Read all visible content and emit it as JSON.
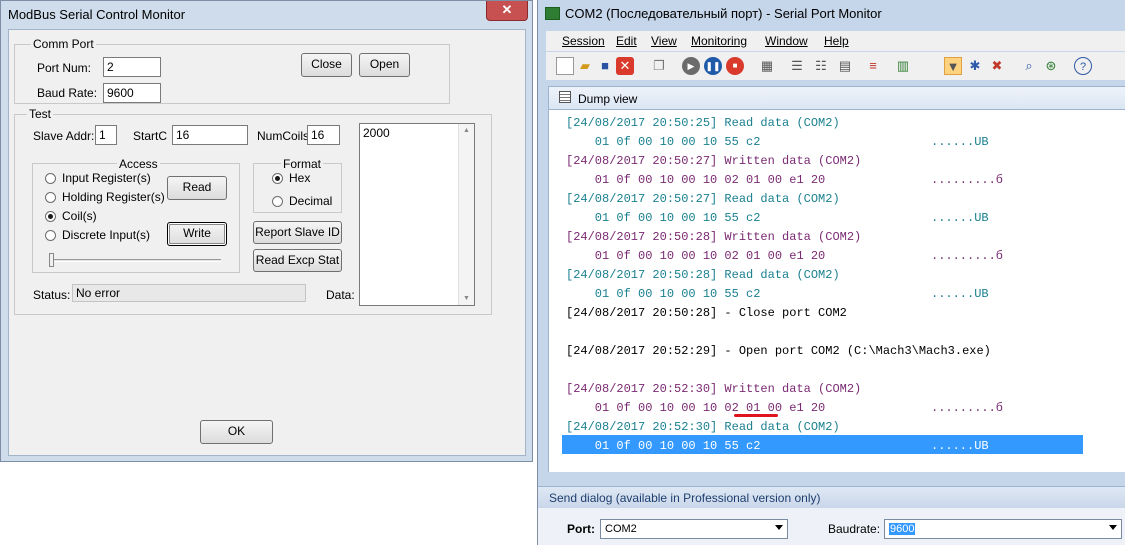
{
  "left_window": {
    "title": "ModBus Serial Control Monitor",
    "close_glyph": "✕",
    "comm_port": {
      "group_label": "Comm Port",
      "port_num_label": "Port Num:",
      "port_num_value": "2",
      "baud_rate_label": "Baud Rate:",
      "baud_rate_value": "9600",
      "close_button": "Close",
      "open_button": "Open"
    },
    "test": {
      "group_label": "Test",
      "slave_addr_label": "Slave Addr:",
      "slave_addr_value": "1",
      "startc_label": "StartC",
      "startc_value": "16",
      "numcoils_label": "NumCoils:",
      "numcoils_value": "16",
      "data_value": "2000",
      "access": {
        "label": "Access",
        "options": [
          "Input Register(s)",
          "Holding Register(s)",
          "Coil(s)",
          "Discrete Input(s)"
        ],
        "selected": "Coil(s)",
        "read_button": "Read",
        "write_button": "Write"
      },
      "format": {
        "label": "Format",
        "options": [
          "Hex",
          "Decimal"
        ],
        "selected": "Hex"
      },
      "report_slave_id_button": "Report Slave ID",
      "read_excp_stat_button": "Read Excp Stat",
      "status_label": "Status:",
      "status_value": "No error",
      "data_label": "Data:"
    },
    "ok_button": "OK"
  },
  "right_window": {
    "title": "COM2 (Последовательный порт) - Serial Port Monitor",
    "menu": [
      "Session",
      "Edit",
      "View",
      "Monitoring",
      "Window",
      "Help"
    ],
    "panel_title": "Dump view",
    "log": [
      {
        "text": "[24/08/2017 20:50:25] Read data (COM2)",
        "kind": "read-hdr"
      },
      {
        "text": "    01 0f 00 10 00 10 55 c2",
        "ascii": "......UB",
        "kind": "data"
      },
      {
        "text": "[24/08/2017 20:50:27] Written data (COM2)",
        "kind": "write-hdr"
      },
      {
        "text": "    01 0f 00 10 00 10 02 01 00 e1 20",
        "ascii": ".........б",
        "kind": "data-w"
      },
      {
        "text": "[24/08/2017 20:50:27] Read data (COM2)",
        "kind": "read-hdr"
      },
      {
        "text": "    01 0f 00 10 00 10 55 c2",
        "ascii": "......UB",
        "kind": "data"
      },
      {
        "text": "[24/08/2017 20:50:28] Written data (COM2)",
        "kind": "write-hdr"
      },
      {
        "text": "    01 0f 00 10 00 10 02 01 00 e1 20",
        "ascii": ".........б",
        "kind": "data-w"
      },
      {
        "text": "[24/08/2017 20:50:28] Read data (COM2)",
        "kind": "read-hdr"
      },
      {
        "text": "    01 0f 00 10 00 10 55 c2",
        "ascii": "......UB",
        "kind": "data"
      },
      {
        "text": "[24/08/2017 20:50:28] - Close port COM2",
        "kind": "plain"
      },
      {
        "text": "",
        "kind": "plain"
      },
      {
        "text": "[24/08/2017 20:52:29] - Open port COM2 (C:\\Mach3\\Mach3.exe)",
        "kind": "plain"
      },
      {
        "text": "",
        "kind": "plain"
      },
      {
        "text": "[24/08/2017 20:52:30] Written data (COM2)",
        "kind": "write-hdr"
      },
      {
        "text": "    01 0f 00 10 00 10 02 01 00 e1 20",
        "ascii": ".........б",
        "kind": "data-w"
      },
      {
        "text": "[24/08/2017 20:52:30] Read data (COM2)",
        "kind": "read-hdr"
      },
      {
        "text": "    01 0f 00 10 00 10 55 c2",
        "ascii": "......UB",
        "kind": "selected"
      }
    ],
    "send_dialog_title": "Send dialog (available in Professional version only)",
    "port_label": "Port:",
    "port_value": "COM2",
    "baudrate_label": "Baudrate:",
    "baudrate_value": "9600"
  },
  "colors": {
    "read": "#1a8090",
    "written": "#7a2a72",
    "selection": "#3399ff",
    "underline_mark": "#e0141e"
  }
}
